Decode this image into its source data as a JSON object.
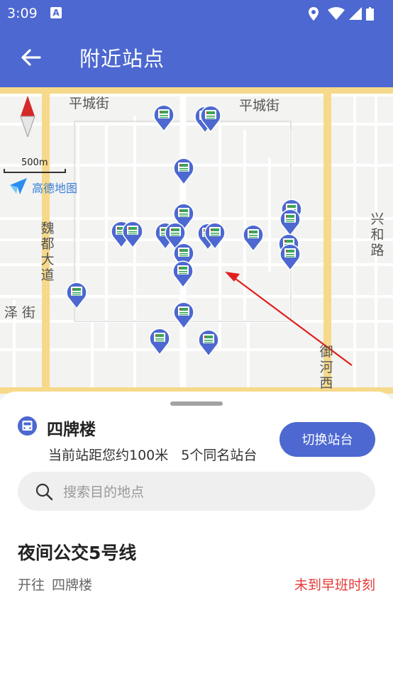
{
  "status_bar": {
    "time": "3:09",
    "notification_letter": "A",
    "icons": [
      "location-icon",
      "wifi-icon",
      "signal-icon",
      "battery-icon"
    ]
  },
  "app_bar": {
    "title": "附近站点",
    "back_icon": "arrow-left-icon"
  },
  "map": {
    "streets": [
      "平城街",
      "平城街",
      "魏都大道",
      "泽 街",
      "兴和路",
      "御河西"
    ],
    "scale_label": "500m",
    "logo_text": "高德地图",
    "pin_icon": "bus-stop-pin-icon",
    "annotation": "red-arrow"
  },
  "station": {
    "name": "四牌楼",
    "distance": "当前站距您约100米",
    "same_name_count": "5个同名站台",
    "switch_label": "切换站台"
  },
  "search": {
    "placeholder": "搜索目的地点"
  },
  "route": {
    "name": "夜间公交5号线",
    "direction_prefix": "开往",
    "direction_dest": "四牌楼",
    "status": "未到早班时刻"
  },
  "colors": {
    "primary": "#4d68d0",
    "road_major": "#f6d98a",
    "alert": "#e53935"
  }
}
